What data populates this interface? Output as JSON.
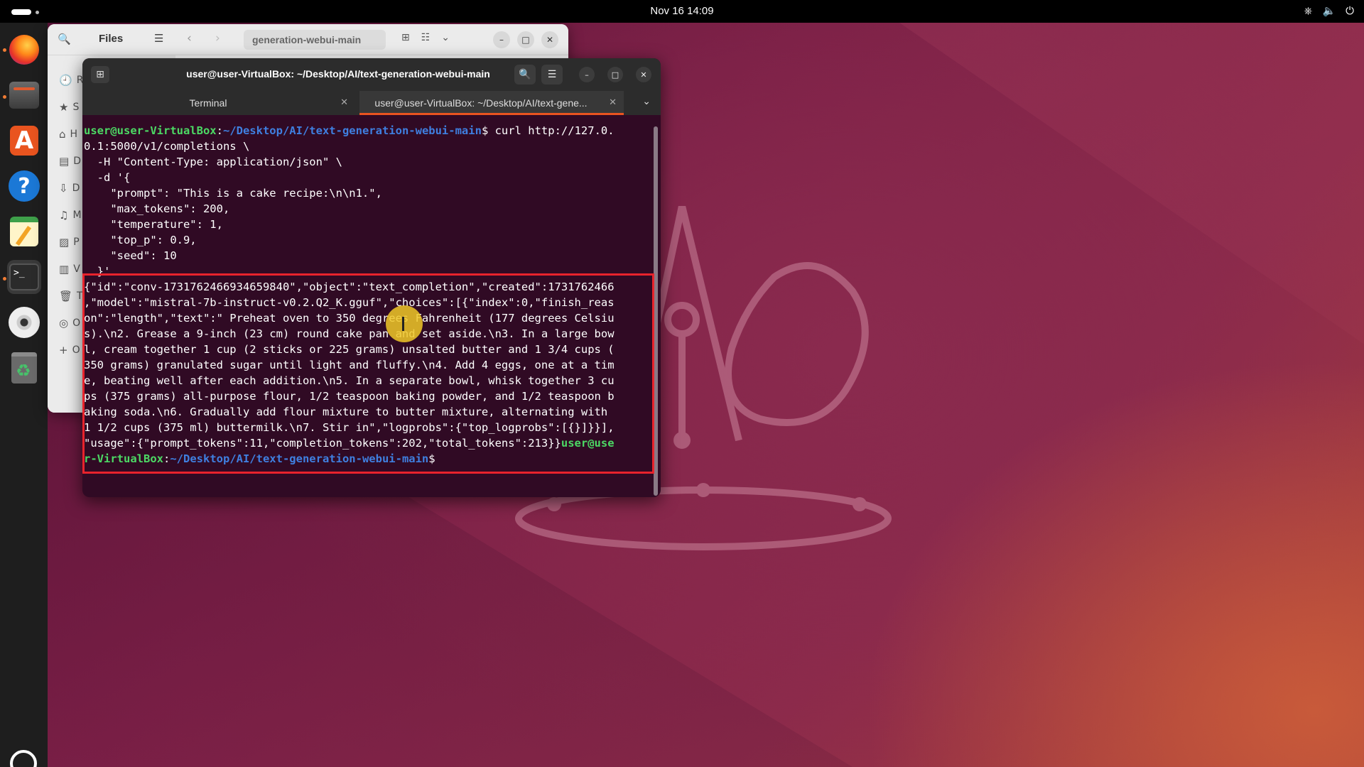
{
  "topbar": {
    "clock": "Nov 16  14:09",
    "tray_icons": [
      "network-icon",
      "volume-icon",
      "power-icon"
    ]
  },
  "dock": {
    "apps": [
      "Firefox",
      "Files",
      "App Center",
      "Help",
      "Text Editor",
      "Terminal",
      "DVD",
      "Trash"
    ]
  },
  "files_window": {
    "title": "Files",
    "path": "generation-webui-main",
    "sidebar_letters": [
      "R",
      "S",
      "H",
      "D",
      "D",
      "M",
      "P",
      "V",
      "T",
      "",
      "+",
      "O"
    ]
  },
  "terminal": {
    "title": "user@user-VirtualBox: ~/Desktop/AI/text-generation-webui-main",
    "tabs": [
      {
        "label": "Terminal"
      },
      {
        "label": "user@user-VirtualBox: ~/Desktop/AI/text-gene..."
      }
    ],
    "prompt_user": "user@user-VirtualBox",
    "prompt_path": "~/Desktop/AI/text-generation-webui-main",
    "lines": [
      "$ curl http://127.0.",
      "0.1:5000/v1/completions \\",
      "  -H \"Content-Type: application/json\" \\",
      "  -d '{",
      "    \"prompt\": \"This is a cake recipe:\\n\\n1.\",",
      "    \"max_tokens\": 200,",
      "    \"temperature\": 1,",
      "    \"top_p\": 0.9,",
      "    \"seed\": 10",
      "  }'",
      "{\"id\":\"conv-1731762466934659840\",\"object\":\"text_completion\",\"created\":1731762466",
      ",\"model\":\"mistral-7b-instruct-v0.2.Q2_K.gguf\",\"choices\":[{\"index\":0,\"finish_reas",
      "on\":\"length\",\"text\":\" Preheat oven to 350 degrees Fahrenheit (177 degrees Celsiu",
      "s).\\n2. Grease a 9-inch (23 cm) round cake pan and set aside.\\n3. In a large bow",
      "l, cream together 1 cup (2 sticks or 225 grams) unsalted butter and 1 3/4 cups (",
      "350 grams) granulated sugar until light and fluffy.\\n4. Add 4 eggs, one at a tim",
      "e, beating well after each addition.\\n5. In a separate bowl, whisk together 3 cu",
      "ps (375 grams) all-purpose flour, 1/2 teaspoon baking powder, and 1/2 teaspoon b",
      "aking soda.\\n6. Gradually add flour mixture to butter mixture, alternating with",
      "1 1/2 cups (375 ml) buttermilk.\\n7. Stir in\",\"logprobs\":{\"top_logprobs\":[{}]}}],",
      "\"usage\":{\"prompt_tokens\":11,\"completion_tokens\":202,\"total_tokens\":213}}"
    ],
    "final_prompt_user_a": "user@use",
    "final_prompt_user_b": "r-VirtualBox",
    "final_prompt_suffix": "$"
  }
}
